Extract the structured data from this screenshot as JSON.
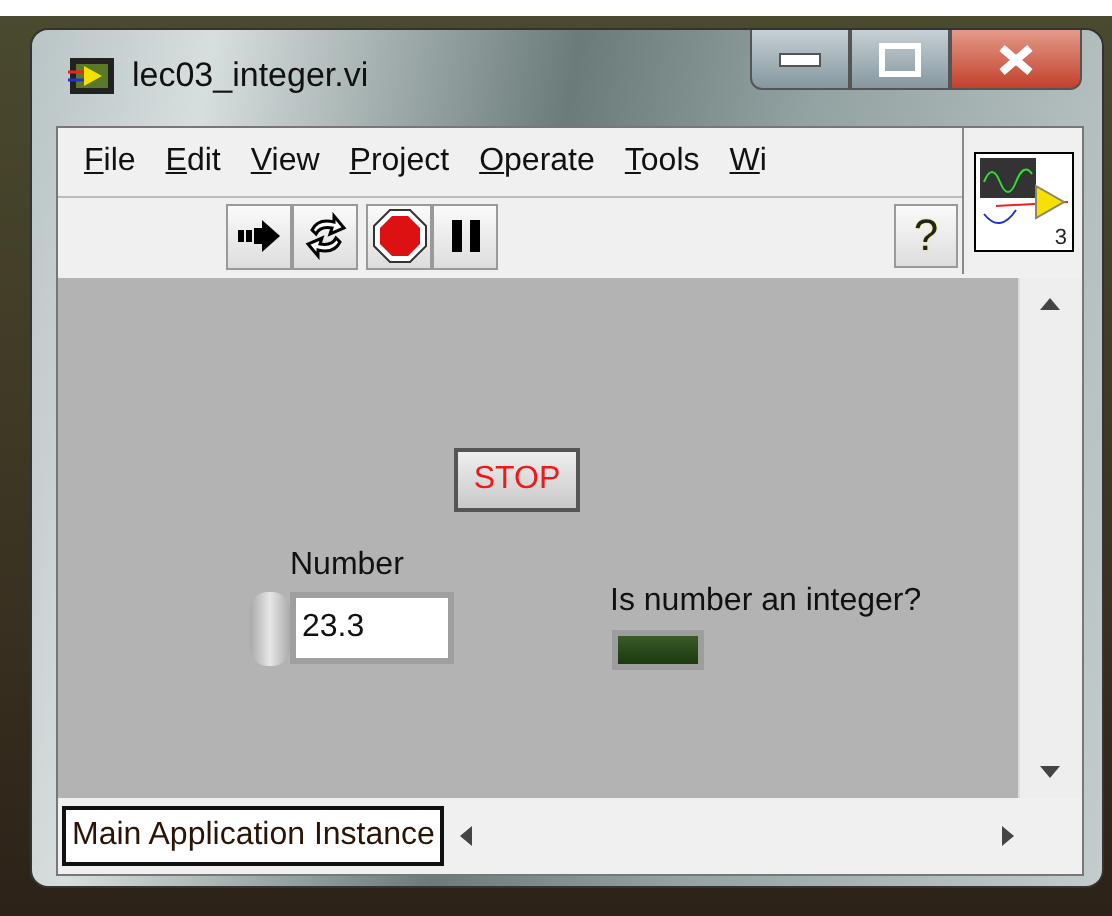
{
  "window": {
    "title": "lec03_integer.vi"
  },
  "menu": [
    "File",
    "Edit",
    "View",
    "Project",
    "Operate",
    "Tools",
    "Wi"
  ],
  "toolbar": {
    "help": "?",
    "connector_label": "3"
  },
  "front_panel": {
    "stop_button": "STOP",
    "numeric": {
      "label": "Number",
      "value": "23.3"
    },
    "indicator": {
      "label": "Is number an integer?",
      "on": false
    }
  },
  "status_bar": {
    "context": "Main Application Instance"
  }
}
